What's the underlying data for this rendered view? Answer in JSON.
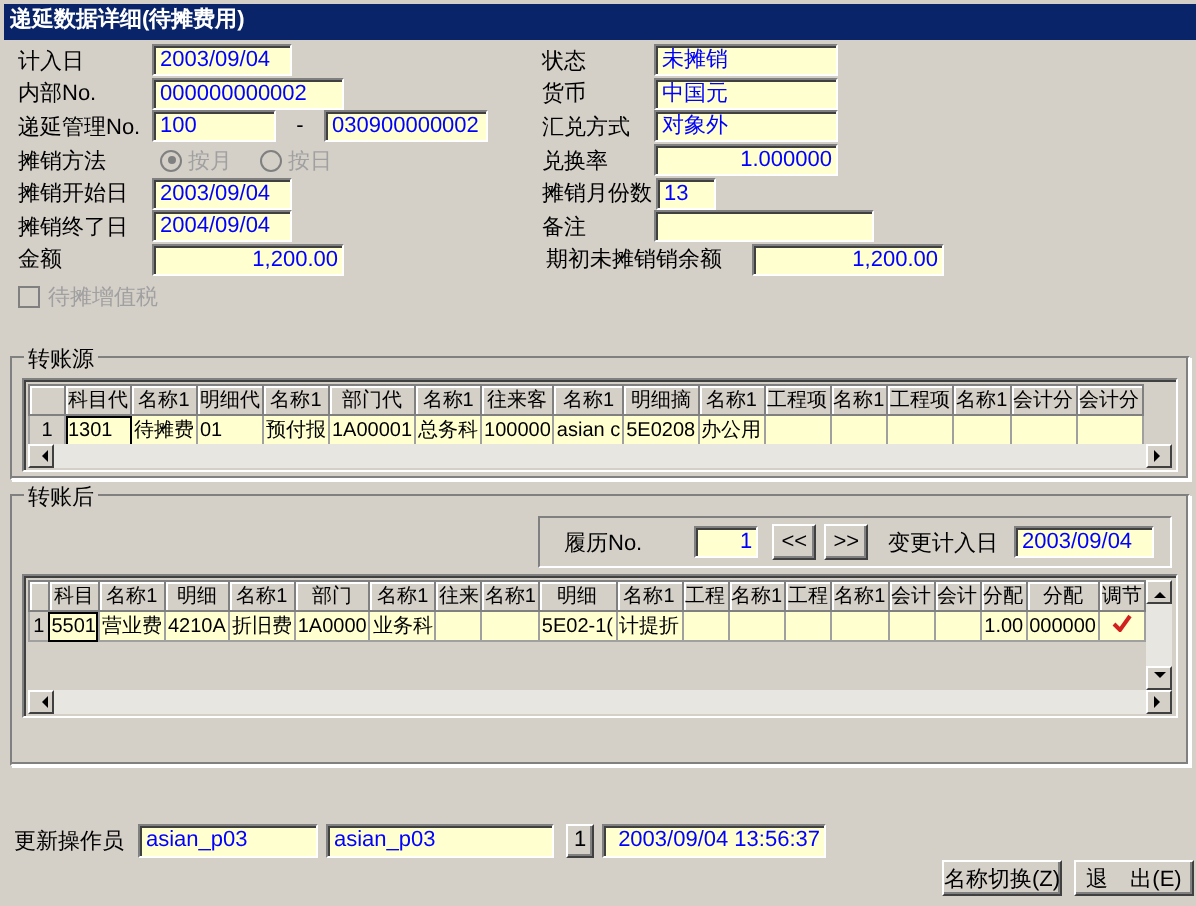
{
  "window": {
    "title": "递延数据详细(待摊费用)"
  },
  "form": {
    "left": [
      {
        "kind": "text",
        "label": "计入日",
        "value": "2003/09/04"
      },
      {
        "kind": "text",
        "label": "内部No.",
        "value": "000000000002"
      },
      {
        "kind": "pair",
        "label": "递延管理No.",
        "values": [
          "100",
          "030900000002"
        ],
        "separator": "-"
      },
      {
        "kind": "radio",
        "label": "摊销方法",
        "disabled": true,
        "options": [
          {
            "label": "按月",
            "selected": true
          },
          {
            "label": "按日",
            "selected": false
          }
        ]
      },
      {
        "kind": "text",
        "label": "摊销开始日",
        "value": "2003/09/04"
      },
      {
        "kind": "text",
        "label": "摊销终了日",
        "value": "2004/09/04"
      },
      {
        "kind": "number",
        "label": "金额",
        "value": "1,200.00"
      }
    ],
    "right": [
      {
        "kind": "text",
        "label": "状态",
        "value": "未摊销"
      },
      {
        "kind": "text",
        "label": "货币",
        "value": "中国元"
      },
      {
        "kind": "text",
        "label": "汇兑方式",
        "value": "对象外"
      },
      {
        "kind": "number",
        "label": "兑换率",
        "value": "1.000000"
      },
      {
        "kind": "text",
        "label": "摊销月份数",
        "value": "13"
      },
      {
        "kind": "text",
        "label": "备注"
      },
      {
        "kind": "number",
        "label": "期初未摊销销余额",
        "value": "1,200.00"
      }
    ]
  },
  "tax_checkbox": {
    "label": "待摊增值税",
    "checked": false,
    "disabled": true
  },
  "transfer_source": {
    "title": "转账源",
    "grid": {
      "columns": [
        "科目代",
        "名称1",
        "明细代",
        "名称1",
        "部门代",
        "名称1",
        "往来客",
        "名称1",
        "明细摘",
        "名称1",
        "工程项",
        "名称1",
        "工程项",
        "名称1",
        "会计分",
        "会计分"
      ],
      "rows": [
        {
          "number": "1",
          "cells": [
            "1301",
            "待摊费",
            "01",
            "预付报",
            "1A00001",
            "总务科",
            "100000",
            "asian c",
            "5E0208",
            "办公用",
            null,
            null,
            null,
            null,
            null,
            null
          ]
        }
      ]
    }
  },
  "transfer_target": {
    "title": "转账后",
    "history": {
      "label": "履历No.",
      "value": "1"
    },
    "nav_buttons": [
      "<<",
      ">>"
    ],
    "change_date": {
      "label": "变更计入日",
      "value": "2003/09/04"
    },
    "grid": {
      "columns": [
        "科目",
        "名称1",
        "明细",
        "名称1",
        "部门",
        "名称1",
        "往来",
        "名称1",
        "明细",
        "名称1",
        "工程",
        "名称1",
        "工程",
        "名称1",
        "会计",
        "会计",
        "分配",
        "分配",
        "调节"
      ],
      "rows": [
        {
          "number": "1",
          "cells": [
            "5501",
            "营业费",
            "4210A",
            "折旧费",
            "1A0000",
            "业务科",
            null,
            null,
            "5E02-1(",
            "计提折",
            null,
            null,
            null,
            null,
            null,
            null,
            "1.00",
            "000000",
            {
              "kind": "check",
              "checked": true
            }
          ]
        }
      ]
    }
  },
  "updated_by": {
    "label": "更新操作员",
    "values": [
      "asian_p03",
      "asian_p03"
    ],
    "button": "1",
    "timestamp": "2003/09/04 13:56:37"
  },
  "buttons": [
    "名称切换(Z)",
    "退　出(E)"
  ]
}
